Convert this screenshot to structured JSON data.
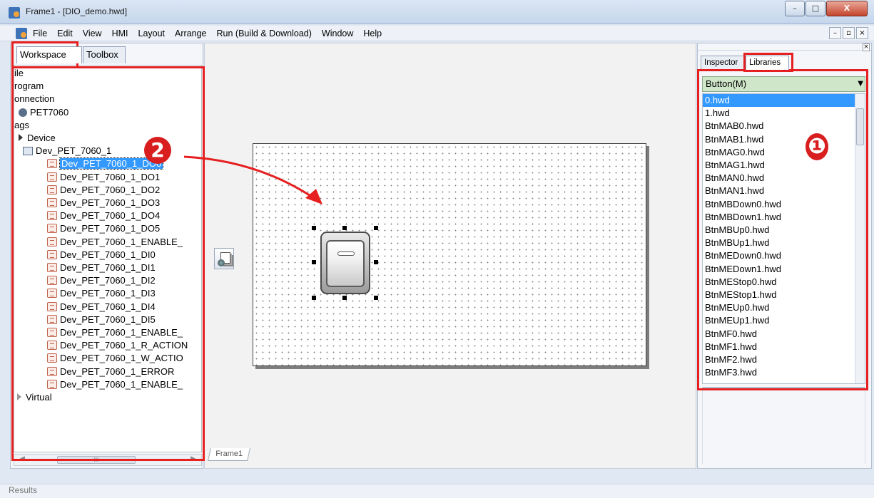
{
  "window": {
    "title": "Frame1 - [DIO_demo.hwd]",
    "controls": [
      "–",
      "□",
      "X"
    ]
  },
  "menubar": {
    "items": [
      "File",
      "Edit",
      "View",
      "HMI",
      "Layout",
      "Arrange",
      "Run (Build & Download)",
      "Window",
      "Help"
    ],
    "mdi_controls": [
      "–",
      "▫",
      "×"
    ]
  },
  "left_panel": {
    "tabs": [
      "Workspace",
      "Toolbox"
    ],
    "tree": [
      {
        "label": "ile",
        "kind": "text"
      },
      {
        "label": "rogram",
        "kind": "text"
      },
      {
        "label": "onnection",
        "kind": "text"
      },
      {
        "label": "PET7060",
        "kind": "net"
      },
      {
        "label": "ags",
        "kind": "text"
      },
      {
        "label": "Device",
        "kind": "folder"
      },
      {
        "label": "Dev_PET_7060_1",
        "kind": "device"
      },
      {
        "label": "Dev_PET_7060_1_DO0",
        "kind": "tag",
        "selected": true
      },
      {
        "label": "Dev_PET_7060_1_DO1",
        "kind": "tag"
      },
      {
        "label": "Dev_PET_7060_1_DO2",
        "kind": "tag"
      },
      {
        "label": "Dev_PET_7060_1_DO3",
        "kind": "tag"
      },
      {
        "label": "Dev_PET_7060_1_DO4",
        "kind": "tag"
      },
      {
        "label": "Dev_PET_7060_1_DO5",
        "kind": "tag"
      },
      {
        "label": "Dev_PET_7060_1_ENABLE_",
        "kind": "tag"
      },
      {
        "label": "Dev_PET_7060_1_DI0",
        "kind": "tag"
      },
      {
        "label": "Dev_PET_7060_1_DI1",
        "kind": "tag"
      },
      {
        "label": "Dev_PET_7060_1_DI2",
        "kind": "tag"
      },
      {
        "label": "Dev_PET_7060_1_DI3",
        "kind": "tag"
      },
      {
        "label": "Dev_PET_7060_1_DI4",
        "kind": "tag"
      },
      {
        "label": "Dev_PET_7060_1_DI5",
        "kind": "tag"
      },
      {
        "label": "Dev_PET_7060_1_ENABLE_",
        "kind": "tag"
      },
      {
        "label": "Dev_PET_7060_1_R_ACTION",
        "kind": "tag"
      },
      {
        "label": "Dev_PET_7060_1_W_ACTIO",
        "kind": "tag"
      },
      {
        "label": "Dev_PET_7060_1_ERROR",
        "kind": "tag"
      },
      {
        "label": "Dev_PET_7060_1_ENABLE_",
        "kind": "tag"
      },
      {
        "label": "Virtual",
        "kind": "folder-light"
      }
    ],
    "hscroll_grip": "III"
  },
  "center": {
    "frame_tab": "Frame1"
  },
  "right_panel": {
    "tabs": [
      "Inspector",
      "Libraries"
    ],
    "library_select": "Button(M)",
    "library_items": [
      "0.hwd",
      "1.hwd",
      "BtnMAB0.hwd",
      "BtnMAB1.hwd",
      "BtnMAG0.hwd",
      "BtnMAG1.hwd",
      "BtnMAN0.hwd",
      "BtnMAN1.hwd",
      "BtnMBDown0.hwd",
      "BtnMBDown1.hwd",
      "BtnMBUp0.hwd",
      "BtnMBUp1.hwd",
      "BtnMEDown0.hwd",
      "BtnMEDown1.hwd",
      "BtnMEStop0.hwd",
      "BtnMEStop1.hwd",
      "BtnMEUp0.hwd",
      "BtnMEUp1.hwd",
      "BtnMF0.hwd",
      "BtnMF1.hwd",
      "BtnMF2.hwd",
      "BtnMF3.hwd"
    ],
    "selected_item": "0.hwd"
  },
  "annotations": {
    "badge_1": "❶",
    "badge_2": "2",
    "color": "#e62020"
  },
  "results": {
    "label": "Results"
  }
}
